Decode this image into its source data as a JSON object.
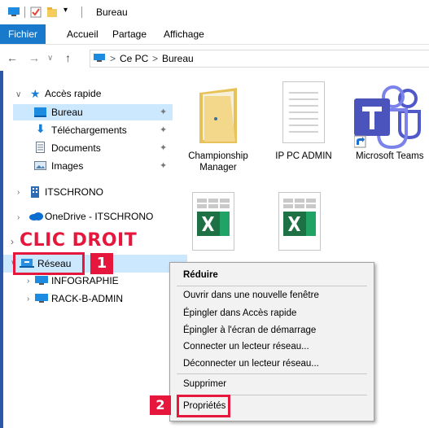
{
  "window": {
    "title": "Bureau"
  },
  "ribbon": {
    "tabs": [
      "Fichier",
      "Accueil",
      "Partage",
      "Affichage"
    ]
  },
  "address": {
    "crumbs": [
      "Ce PC",
      "Bureau"
    ],
    "separator": ">"
  },
  "nav": {
    "quick_access": "Accès rapide",
    "items": [
      "Bureau",
      "Téléchargements",
      "Documents",
      "Images"
    ],
    "itschrono": "ITSCHRONO",
    "onedrive": "OneDrive - ITSCHRONO",
    "network": "Réseau",
    "network_children": [
      "INFOGRAPHIE",
      "RACK-B-ADMIN"
    ]
  },
  "files": [
    {
      "name": "Championship\nManager",
      "icon": "folder-icon"
    },
    {
      "name": "IP PC ADMIN",
      "icon": "text-file-icon"
    },
    {
      "name": "Microsoft Teams",
      "icon": "teams-icon"
    },
    {
      "name": "",
      "icon": "excel-file-icon"
    },
    {
      "name": "",
      "icon": "excel-file-icon"
    }
  ],
  "annotations": {
    "instruction": "CLIC DROIT",
    "step1": "1",
    "step2": "2",
    "accent": "#e5173c"
  },
  "context_menu": {
    "header": "Réduire",
    "group1": [
      "Ouvrir dans une nouvelle fenêtre",
      "Épingler dans Accès rapide",
      "Épingler à l'écran de démarrage",
      "Connecter un lecteur réseau...",
      "Déconnecter un lecteur réseau..."
    ],
    "delete": "Supprimer",
    "properties": "Propriétés"
  },
  "colors": {
    "ribbon_active": "#1979ca",
    "selection": "#cce8ff",
    "annotation_red": "#e5173c"
  }
}
